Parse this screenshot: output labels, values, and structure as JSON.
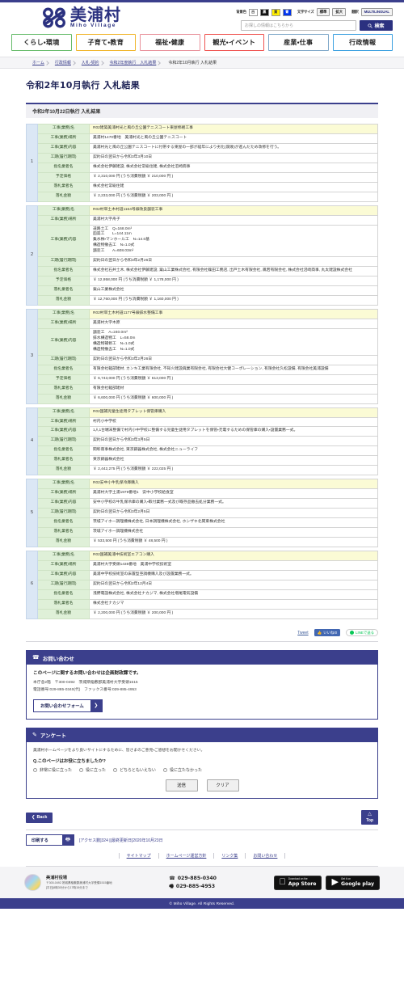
{
  "site": {
    "brand_jp": "美浦村",
    "brand_en": "Miho Village"
  },
  "header": {
    "color_label": "背景色",
    "swatches": [
      {
        "name": "white",
        "text": "白"
      },
      {
        "name": "black",
        "text": "黒"
      },
      {
        "name": "yellow",
        "text": "黄"
      },
      {
        "name": "blue",
        "text": "青"
      }
    ],
    "textsize_label": "文字サイズ",
    "textsize_normal": "標準",
    "textsize_large": "拡大",
    "translate_label": "翻訳",
    "multilingual": "MULTILINGUAL",
    "search_placeholder": "お探しの情報はこちらから",
    "search_value": "",
    "search_button": "検索"
  },
  "mainnav": [
    {
      "label": "くらし・環境",
      "color": "#66bb6a"
    },
    {
      "label": "子育て・教育",
      "color": "#f0b429"
    },
    {
      "label": "福祉・健康",
      "color": "#e8909a"
    },
    {
      "label": "観光・イベント",
      "color": "#ef5350"
    },
    {
      "label": "産業・仕事",
      "color": "#7fa8c9"
    },
    {
      "label": "行政情報",
      "color": "#3aa0e0"
    }
  ],
  "breadcrumb": [
    "ホーム",
    "行政情報",
    "入札-契約",
    "令和2年度執行　入札結果",
    "令和2年10月執行 入札結果"
  ],
  "main": {
    "page_title": "令和2年10月執行 入札結果",
    "section_head": "令和2年10月22日執行 入札結果",
    "labels": {
      "name": "工事(業務)名",
      "place": "工事(業務)場所",
      "content": "工事(業務)内容",
      "period": "工期(履行期間)",
      "nominees": "指名業者名",
      "est_price": "予定価格",
      "winner": "落札業者名",
      "bid_amount": "落札金額"
    },
    "rows": [
      {
        "no": "1",
        "name": "R02建築美浦村光と風の丘公園テニスコート東屋修繕工事",
        "place": "美浦村1470番地　美浦村光と風の丘公園テニスコート",
        "content": "美浦村光と風の丘公園テニスコートに付帯する東屋の一部が経年により劣化(腐敗)が進んだため改修を行う。",
        "period": "契約日の翌日から令和3年3月10日",
        "nominees": "株式会社伊藤建設, 株式会社常総住建, 株式会社沼崎商事",
        "est_price": "￥ 2,310,000 円 (うち消費税額 ￥ 210,000 円 )",
        "winner": "株式会社常総住建",
        "bid_amount": "￥ 2,233,000 円 (うち消費税額 ￥ 203,000 円 )"
      },
      {
        "no": "2",
        "name": "R02村単土木村道1164号線改良舗装工事",
        "place": "美浦村大字舟子",
        "content": "道路土工　Q=168.0m³\n函渠工　　L=144.11m\n集水桝・マンホール工　N=14.0基\n構造物撤去工　N=1.0式\n舗装工　　A=608.03m²",
        "period": "契約日の翌日から令和3年2月26日",
        "nominees": "株式会社石井土木, 株式会社伊藤建設, 粟山工業株式会社, 有限会社篠田工務店, 出戸土木有限会社, 鳳若有限会社, 株式会社沼崎商事, 丸太建設株式会社",
        "est_price": "￥ 12,958,000 円 (うち消費税額 ￥ 1,178,000 円 )",
        "winner": "粟山工業株式会社",
        "bid_amount": "￥ 12,760,000 円 (うち消費税額 ￥ 1,160,000 円 )"
      },
      {
        "no": "3",
        "name": "R02村単土木村道1177号線排水整備工事",
        "place": "美浦村大字木原",
        "content": "舗装工　A=240.0m²\n排水構造物工　L=58.0m\n構造物補修工　N=1.0式\n構造物撤去工　N=1.0式",
        "period": "契約日の翌日から令和3年2月26日",
        "nominees": "有限会社軽部建材, カンキ工業有限会社, 不知火建設興業有限会社, 有限会社大健コーポレーション, 有限会社久松設備, 有限会社美浦設備",
        "est_price": "￥ 6,743,000 円 (うち消費税額 ￥ 613,000 円 )",
        "winner": "有限会社軽部建材",
        "bid_amount": "￥ 6,600,000 円 (うち消費税額 ￥ 600,000 円 )"
      },
      {
        "no": "4",
        "name": "R02国補児童生徒用タブレット保管庫購入",
        "place": "村内小中学校",
        "content": "1人1台端末整備で村内小中学校に整備する児童生徒用タブレットを保管・充電するための保管庫の購入・設置業務一式。",
        "period": "契約日の翌日から令和3年3月5日",
        "nominees": "関彰商事株式会社, 東京銅器株式会社, 株式会社ニューライフ",
        "est_price": "",
        "winner": "東京銅器株式会社",
        "bid_amount": "￥ 2,442,275 円 (うち消費税額 ￥ 222,025 円 )"
      },
      {
        "no": "5",
        "name": "R02安中小牛乳保冷庫購入",
        "place": "美浦村大字土浦1979番地1　安中小学校給食室",
        "content": "安中小学校の牛乳保冷庫の購入・取付業務一式及び既存品撤去処分業務一式。",
        "period": "契約日の翌日から令和3年2月5日",
        "nominees": "茨城アイホー調理機株式会社, 日本調理機株式会社, ホシザキ北関東株式会社",
        "est_price": "",
        "winner": "茨城アイホー調理機株式会社",
        "bid_amount": "￥ 533,500 円 (うち消費税額 ￥ 48,500 円 )"
      },
      {
        "no": "6",
        "name": "R02国補美浦中技術室エアコン購入",
        "place": "美浦村大字受領1435番地　美浦中学校技術室",
        "content": "美浦中学校技術室の床置型空調機購入及び設置業務一式。",
        "period": "契約日の翌日から令和2年12月4日",
        "nominees": "浅野電設株式会社, 株式会社ナカジマ, 株式会社増尾電気設備",
        "est_price": "",
        "winner": "株式会社ナカジマ",
        "bid_amount": "￥ 2,200,000 円 (うち消費税額 ￥ 200,000 円 )"
      }
    ]
  },
  "share": {
    "tweet": "Tweet",
    "facebook": "いいね!0",
    "line": "LINEで送る"
  },
  "inquiry": {
    "heading": "お問い合わせ",
    "lead": "このページに関するお問い合わせは企画財政課です。",
    "address": "本庁舎2階　〒300-0492　茨城県稲敷郡美浦村大字受領1515",
    "tel_line": "電話番号:029-885-0340(代)　ファックス番号:029-885-4953",
    "form_button": "お問い合わせフォーム",
    "form_arrow": "❯"
  },
  "survey": {
    "heading": "アンケート",
    "lead": "美浦村ホームページをより良いサイトにするために、皆さまのご意見・ご感想をお聞かせください。",
    "question": "Q.このページはお役に立ちましたか?",
    "options": [
      "非常に役に立った",
      "役に立った",
      "どちらともいえない",
      "役に立たなかった"
    ],
    "submit": "送信",
    "clear": "クリア"
  },
  "navfoot": {
    "back": "Back",
    "top_label": "Top",
    "top_arrow": "△",
    "print": "印刷する",
    "meta": "[アクセス数]324 |[最終更新日]2020年10月23日",
    "links": [
      "サイトマップ",
      "ホームページ運営方針",
      "リンク集",
      "お問い合わせ"
    ]
  },
  "footer": {
    "org_name": "美浦村役場",
    "org_address": "〒300-0492 茨城県稲敷郡美浦村大字受領1515番地",
    "org_hours": "[平日]8時30分から17時15分まで",
    "tel": "029-885-0340",
    "fax": "029-885-4953",
    "appstore_small": "Download on the",
    "appstore_big": "App Store",
    "googleplay_small": "Get it on",
    "googleplay_big": "Google play",
    "copyright": "© Miho Village. All Rights Reserved."
  }
}
